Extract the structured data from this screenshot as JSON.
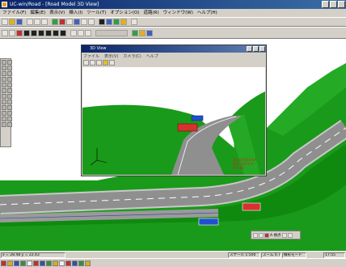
{
  "window": {
    "title": "UC-win/Road - [Road Model 3D View]"
  },
  "menu": [
    "ファイル(F)",
    "編集(E)",
    "表示(V)",
    "挿入(I)",
    "ツール(T)",
    "オプション(O)",
    "道路(R)",
    "ウィンドウ(W)",
    "ヘルプ(H)"
  ],
  "popup": {
    "title": "3D View",
    "menu": [
      "ファイル",
      "表示(V)",
      "カメラ(C)",
      "ヘルプ"
    ],
    "overlay_text": [
      "Speed 40 km/h",
      "Dist 120.5 m",
      "FPS 28"
    ]
  },
  "status": {
    "coords": "x = 28.48  y = 22.43",
    "scale": "スケール 1:500",
    "zoom": "ズーム 0.70",
    "mode": "線形モード",
    "time": "17:55"
  },
  "minitool": {
    "label": "A 視点"
  },
  "colors": {
    "grass": "#1a9a1a",
    "grass_dark": "#0f8a0f",
    "road": "#8f8f8f",
    "road_edge": "#c8c8c8",
    "car_red": "#d83030",
    "car_blue": "#2050d0",
    "sky": "#ffffff"
  }
}
